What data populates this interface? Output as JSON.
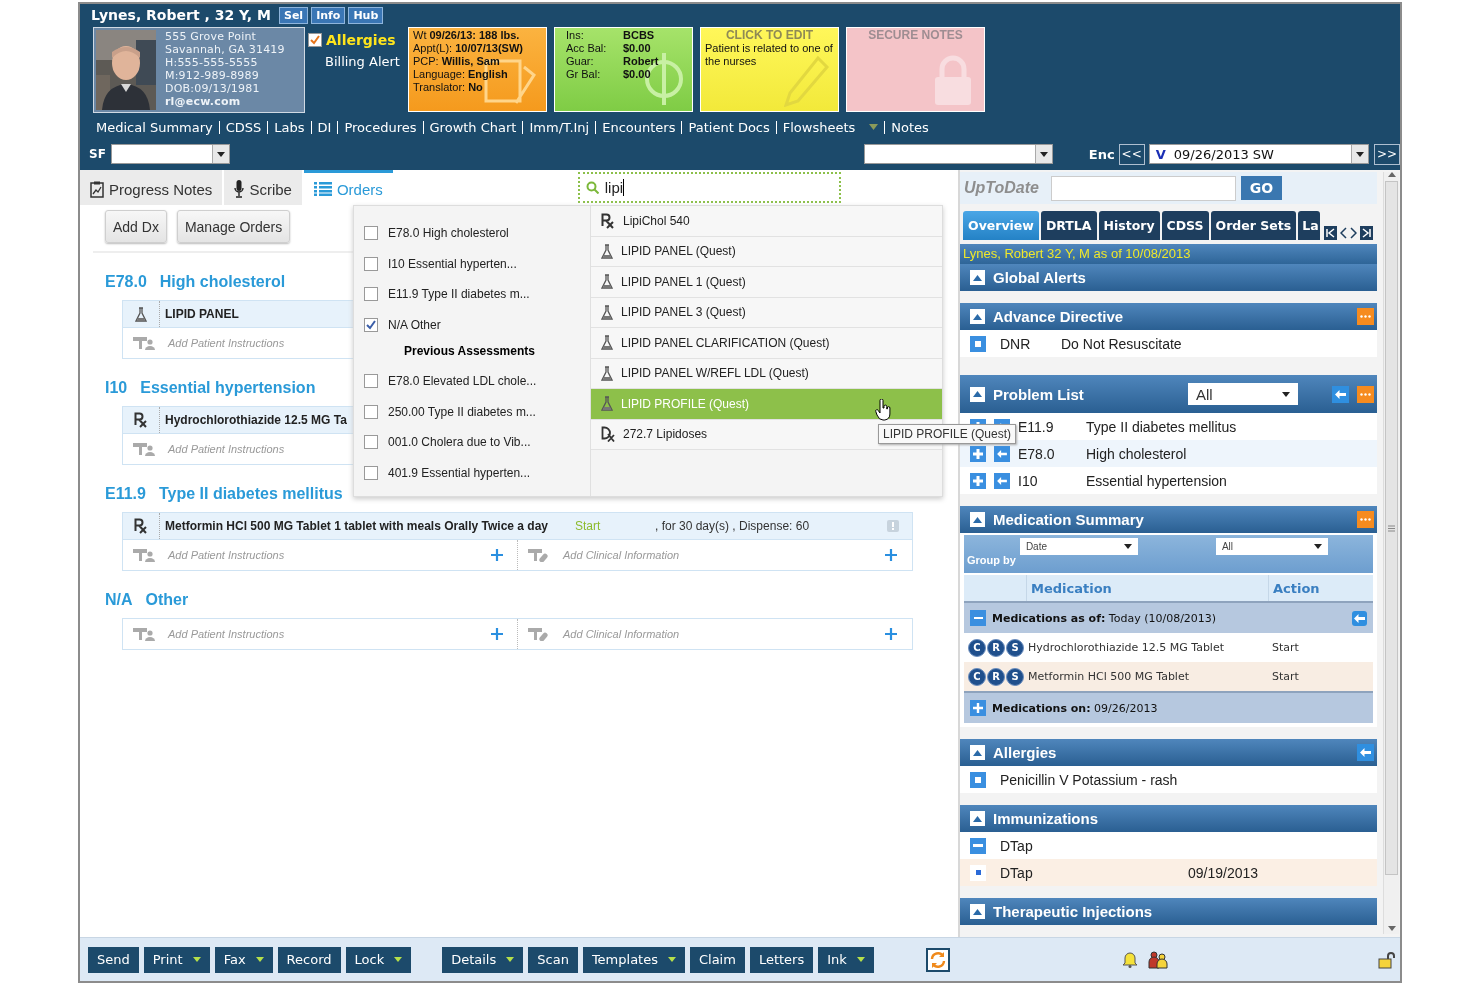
{
  "header": {
    "patient_name": "Lynes, Robert , 32 Y, M",
    "buttons": [
      "Sel",
      "Info",
      "Hub"
    ],
    "address": [
      "555 Grove Point",
      "Savannah, GA 31419",
      "H:555-555-5555",
      "M:912-989-8989",
      "DOB:09/13/1981"
    ],
    "email": "rl@ecw.com",
    "allergies": {
      "label": "Allergies",
      "checked": true
    },
    "billing": "Billing Alert",
    "vitals_card": [
      {
        "label": "Wt",
        "value": "09/26/13: 188 lbs."
      },
      {
        "label": "Appt(L):",
        "value": "10/07/13(SW)"
      },
      {
        "label": "PCP:",
        "value": "Willis, Sam"
      },
      {
        "label": "Language:",
        "value": "English"
      },
      {
        "label": "Translator:",
        "value": "No"
      }
    ],
    "insurance_card": [
      {
        "label": "Ins:",
        "value": "BCBS"
      },
      {
        "label": "Acc Bal:",
        "value": "$0.00"
      },
      {
        "label": "Guar:",
        "value": "Robert"
      },
      {
        "label": "Gr Bal:",
        "value": "$0.00"
      }
    ],
    "notes_card": {
      "title": "CLICK TO EDIT",
      "text": "Patient is related to one of the nurses"
    },
    "secure_card": {
      "title": "SECURE NOTES"
    },
    "nav": [
      {
        "label": "Medical Summary"
      },
      {
        "label": "CDSS"
      },
      {
        "label": "Labs"
      },
      {
        "label": "DI"
      },
      {
        "label": "Procedures"
      },
      {
        "label": "Growth Chart"
      },
      {
        "label": "Imm/T.Inj"
      },
      {
        "label": "Encounters"
      },
      {
        "label": "Patient Docs"
      },
      {
        "label": "Flowsheets",
        "menu": true
      },
      {
        "label": "Notes"
      }
    ],
    "sf_label": "SF",
    "enc": {
      "label": "Enc",
      "prev": "<<",
      "next": ">>",
      "badge": "V",
      "value": "09/26/2013 SW"
    }
  },
  "orders": {
    "tabs": [
      {
        "label": "Progress Notes",
        "kind": "notes",
        "selected": false
      },
      {
        "label": "Scribe",
        "kind": "scribe",
        "selected": false
      },
      {
        "label": "Orders",
        "kind": "orders",
        "selected": true
      }
    ],
    "search": {
      "value": "lipi"
    },
    "actions": [
      "Add Dx",
      "Manage Orders"
    ],
    "assessments": [
      {
        "code": "E78.0",
        "name": "High cholesterol",
        "orders": [
          {
            "kind": "lab",
            "text": "LIPID PANEL"
          }
        ],
        "patient_instructions": "Add Patient Instructions"
      },
      {
        "code": "I10",
        "name": "Essential hypertension",
        "orders": [
          {
            "kind": "rx",
            "text": "Hydrochlorothiazide 12.5 MG Ta"
          }
        ],
        "patient_instructions": "Add Patient Instructions"
      },
      {
        "code": "E11.9",
        "name": "Type II diabetes mellitus",
        "orders": [
          {
            "kind": "rx",
            "text": "Metformin HCl 500 MG Tablet 1 tablet with meals Orally Twice a day",
            "status": "Start",
            "detail": ", for 30 day(s) , Dispense: 60"
          }
        ],
        "patient_instructions": "Add Patient Instructions",
        "clinical_info": "Add Clinical Information"
      },
      {
        "code": "N/A",
        "name": "Other",
        "patient_instructions": "Add Patient Instructions",
        "clinical_info": "Add Clinical Information"
      }
    ],
    "picker": {
      "assessments": [
        {
          "label": "E78.0 High cholesterol",
          "checked": false
        },
        {
          "label": "I10 Essential hyperten...",
          "checked": false
        },
        {
          "label": "E11.9 Type II diabetes m...",
          "checked": false
        },
        {
          "label": "N/A Other",
          "checked": true
        }
      ],
      "previous_title": "Previous Assessments",
      "previous": [
        {
          "label": "E78.0 Elevated LDL chole...",
          "checked": false
        },
        {
          "label": "250.00 Type II diabetes m...",
          "checked": false
        },
        {
          "label": "001.0 Cholera due to Vib...",
          "checked": false
        },
        {
          "label": "401.9 Essential hyperten...",
          "checked": false
        }
      ],
      "results": [
        {
          "kind": "rx",
          "label": "LipiChol 540",
          "selected": false
        },
        {
          "kind": "lab",
          "label": "LIPID PANEL (Quest)",
          "selected": false
        },
        {
          "kind": "lab",
          "label": "LIPID PANEL 1 (Quest)",
          "selected": false
        },
        {
          "kind": "lab",
          "label": "LIPID PANEL 3 (Quest)",
          "selected": false
        },
        {
          "kind": "lab",
          "label": "LIPID PANEL CLARIFICATION (Quest)",
          "selected": false
        },
        {
          "kind": "lab",
          "label": "LIPID PANEL W/REFL LDL (Quest)",
          "selected": false
        },
        {
          "kind": "lab",
          "label": "LIPID PROFILE (Quest)",
          "selected": true
        },
        {
          "kind": "dx",
          "label": "272.7 Lipidoses",
          "selected": false
        }
      ],
      "tooltip": "LIPID PROFILE (Quest)"
    }
  },
  "sidebar": {
    "search": {
      "label": "UpToDate",
      "button": "GO"
    },
    "tabs": [
      {
        "label": "Overview",
        "selected": true
      },
      {
        "label": "DRTLA",
        "selected": false
      },
      {
        "label": "History",
        "selected": false
      },
      {
        "label": "CDSS",
        "selected": false
      },
      {
        "label": "Order Sets",
        "selected": false
      },
      {
        "label": "La",
        "selected": false
      }
    ],
    "patient_line": "Lynes, Robert 32 Y, M as of 10/08/2013",
    "sections": [
      {
        "kind": "list",
        "title": "Global Alerts"
      },
      {
        "kind": "list",
        "title": "Advance Directive",
        "more": true,
        "rows": [
          {
            "kind": "bullet",
            "cells": [
              "DNR",
              "Do Not Resuscitate"
            ]
          }
        ]
      },
      {
        "kind": "problems",
        "title": "Problem List",
        "filter": "All",
        "back": true,
        "more": true,
        "rows": [
          {
            "code": "E11.9",
            "name": "Type II diabetes mellitus"
          },
          {
            "code": "E78.0",
            "name": "High cholesterol"
          },
          {
            "code": "I10",
            "name": "Essential hypertension"
          }
        ]
      },
      {
        "kind": "medications",
        "title": "Medication Summary",
        "more": true,
        "group_label": "Group by",
        "group_value": "Date",
        "filter": "All",
        "columns": [
          "Medication",
          "Action"
        ],
        "groups": [
          {
            "label": "**Medications as of:** Today (10/08/2013)",
            "expanded": true,
            "back": true,
            "items": [
              {
                "badges": [
                  "C",
                  "R",
                  "S"
                ],
                "name": "Hydrochlorothiazide 12.5 MG Tablet",
                "action": "Start"
              },
              {
                "badges": [
                  "C",
                  "R",
                  "S"
                ],
                "name": "Metformin HCl 500 MG Tablet",
                "action": "Start"
              }
            ]
          },
          {
            "label": "**Medications on:** 09/26/2013",
            "expanded": false
          }
        ]
      },
      {
        "kind": "list",
        "title": "Allergies",
        "back": true,
        "rows": [
          {
            "kind": "bullet",
            "cells": [
              "Penicillin V Potassium - rash"
            ]
          }
        ]
      },
      {
        "kind": "list",
        "title": "Immunizations",
        "rows": [
          {
            "kind": "minus",
            "cells": [
              "DTap"
            ]
          },
          {
            "kind": "dot",
            "cells": [
              "DTap",
              "09/19/2013"
            ]
          }
        ]
      },
      {
        "kind": "list",
        "title": "Therapeutic Injections"
      }
    ]
  },
  "toolbar": {
    "groups": [
      [
        {
          "label": "Send",
          "menu": false
        },
        {
          "label": "Print",
          "menu": true
        },
        {
          "label": "Fax",
          "menu": true
        },
        {
          "label": "Record",
          "menu": false
        },
        {
          "label": "Lock",
          "menu": true
        }
      ],
      [
        {
          "label": "Details",
          "menu": true
        },
        {
          "label": "Scan",
          "menu": false
        },
        {
          "label": "Templates",
          "menu": true
        },
        {
          "label": "Claim",
          "menu": false
        },
        {
          "label": "Letters",
          "menu": false
        },
        {
          "label": "Ink",
          "menu": true
        }
      ]
    ]
  }
}
